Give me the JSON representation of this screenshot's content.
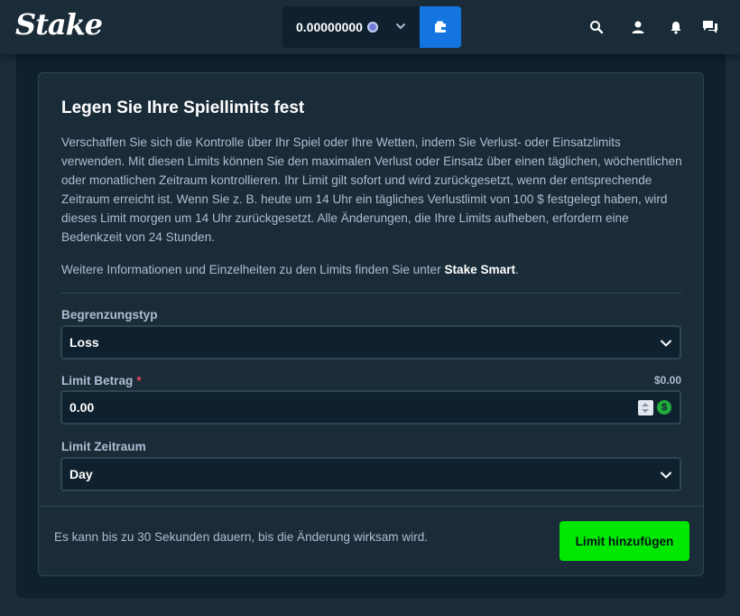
{
  "header": {
    "logo_text": "Stake",
    "wallet_balance": "0.00000000",
    "icons": [
      "search-icon",
      "user-icon",
      "bell-icon",
      "chat-icon"
    ]
  },
  "limits": {
    "title": "Legen Sie Ihre Spiellimits fest",
    "description": "Verschaffen Sie sich die Kontrolle über Ihr Spiel oder Ihre Wetten, indem Sie Verlust- oder Einsatzlimits verwenden. Mit diesen Limits können Sie den maximalen Verlust oder Einsatz über einen täglichen, wöchentlichen oder monatlichen Zeitraum kontrollieren. Ihr Limit gilt sofort und wird zurückgesetzt, wenn der entsprechende Zeitraum erreicht ist. Wenn Sie z. B. heute um 14 Uhr ein tägliches Verlustlimit von 100 $ festgelegt haben, wird dieses Limit morgen um 14 Uhr zurückgesetzt. Alle Änderungen, die Ihre Limits aufheben, erfordern eine Bedenkzeit von 24 Stunden.",
    "more_info_prefix": "Weitere Informationen und Einzelheiten zu den Limits finden Sie unter ",
    "more_info_link": "Stake Smart",
    "more_info_suffix": ".",
    "limit_type": {
      "label": "Begrenzungstyp",
      "value": "Loss"
    },
    "limit_amount": {
      "label": "Limit Betrag",
      "required_mark": "*",
      "max_amount": "$0.00",
      "value": "0.00",
      "currency_symbol": "$"
    },
    "limit_period": {
      "label": "Limit Zeitraum",
      "value": "Day"
    },
    "footnote": "Es kann bis zu 30 Sekunden dauern, bis die Änderung wirksam wird.",
    "submit_label": "Limit hinzufügen"
  },
  "colors": {
    "background": "#1a2c38",
    "panel": "#0f212e",
    "accent_blue": "#1475e1",
    "accent_green": "#00e701",
    "border": "#2f4553"
  }
}
